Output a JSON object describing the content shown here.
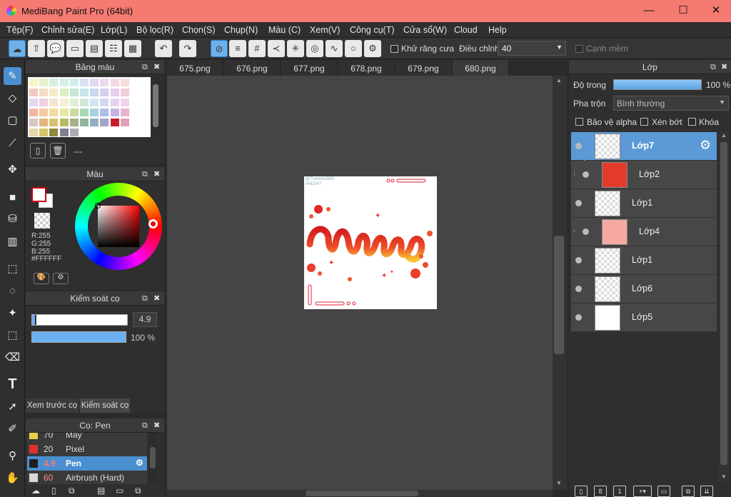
{
  "titlebar": {
    "title": "MediBang Paint Pro (64bit)",
    "minimize": "—",
    "maximize": "☐",
    "close": "✕"
  },
  "menu": [
    "Tệp(F)",
    "Chỉnh sửa(E)",
    "Lớp(L)",
    "Bộ lọc(R)",
    "Chọn(S)",
    "Chụp(N)",
    "Màu (C)",
    "Xem(V)",
    "Công cụ(T)",
    "Cửa sổ(W)",
    "Cloud",
    "Help"
  ],
  "toolbar": {
    "antialias_label": "Khử răng cưa",
    "adjust_label": "Điều chỉnh",
    "adjust_value": "40",
    "edge_label": "Cạnh mềm"
  },
  "palette_panel": {
    "title": "Bảng màu",
    "status": "---",
    "swatches": [
      "#f7f4c7",
      "#e6f2c9",
      "#d6f0d9",
      "#d3efe6",
      "#d0ecf0",
      "#d5e3f2",
      "#e0daf1",
      "#ecd9ef",
      "#f4d9e4",
      "#f9dcd7",
      "#f2c9c1",
      "#f5ddc6",
      "#f4ecc5",
      "#dbeec6",
      "#c7e8d5",
      "#c6e5ec",
      "#c9d7ef",
      "#d8cdee",
      "#e8cdec",
      "#f1cddb",
      "#e6d7f0",
      "#f3cfe2",
      "#f6e2d2",
      "#f7efd0",
      "#e0f0d3",
      "#cfead9",
      "#d2e6f1",
      "#d4d8f3",
      "#e4d3f1",
      "#f0d3ea",
      "#f3b6a5",
      "#f5c8a1",
      "#f2db9c",
      "#e6e8a2",
      "#c8dca1",
      "#a9d9b8",
      "#a6d2df",
      "#b1bde8",
      "#c8b2e4",
      "#e8b4d1",
      "#d8c6c0",
      "#e3b57d",
      "#d8c470",
      "#b8bb62",
      "#a9b08c",
      "#94b59e",
      "#92aebe",
      "#a4a3c7",
      "#c81c2e",
      "#e0a0b8",
      "#e5d7a6",
      "#d8c36a",
      "#8f8a3e",
      "#7f7f8f",
      "#b0a9b5"
    ]
  },
  "color_panel": {
    "title": "Màu",
    "r": "R:255",
    "g": "G:255",
    "b": "B:255",
    "hex": "#FFFFFF"
  },
  "brush_control": {
    "title": "Kiểm soát cọ",
    "size_value": "4.9",
    "size_fraction": 0.04,
    "opacity_value": "100 %",
    "opacity_fraction": 1.0,
    "tab_preview": "Xem trước cọ",
    "tab_control": "Kiểm soát cọ"
  },
  "brush_panel": {
    "title": "Cọ: Pen",
    "items": [
      {
        "size": "70",
        "name": "Mây",
        "color": "#e8d04a"
      },
      {
        "size": "20",
        "name": "Pixel",
        "color": "#e03030"
      },
      {
        "size": "4.9",
        "name": "Pen",
        "color": "#1e1e1e"
      },
      {
        "size": "60",
        "name": "Airbrush (Hard)",
        "color": "#d8d8d8"
      }
    ]
  },
  "tabs": [
    "675.png",
    "676.png",
    "677.png",
    "678.png",
    "679.png",
    "680.png"
  ],
  "artwork": {
    "watermark_line1": "@Tranme1985",
    "watermark_line2": "#HD247"
  },
  "layer_panel": {
    "title": "Lớp",
    "opacity_label": "Độ trong",
    "opacity_value": "100 %",
    "opacity_fraction": 1.0,
    "blend_label": "Pha trộn",
    "blend_value": "Bình thường",
    "protect_alpha": "Bảo vệ alpha",
    "clipping": "Xén bớt",
    "lock": "Khóa",
    "layers": [
      {
        "name": "Lớp7"
      },
      {
        "name": "Lớp2"
      },
      {
        "name": "Lớp1"
      },
      {
        "name": "Lớp4"
      },
      {
        "name": "Lớp1"
      },
      {
        "name": "Lớp6"
      },
      {
        "name": "Lớp5"
      }
    ]
  }
}
